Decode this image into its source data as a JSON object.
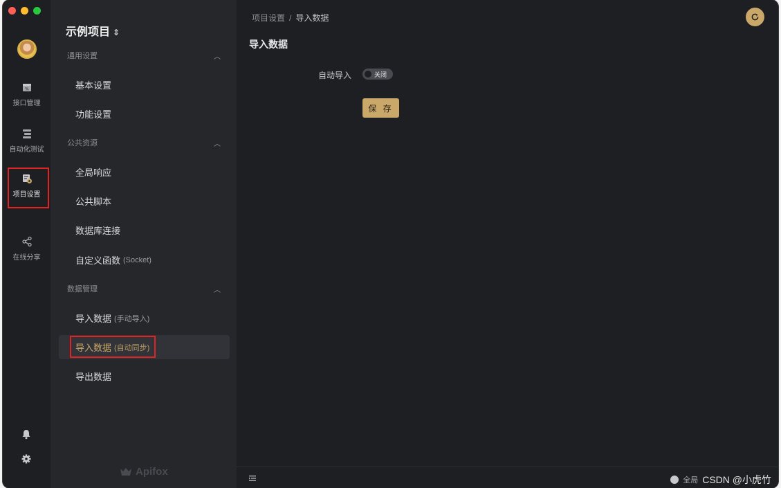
{
  "rail": {
    "items": [
      {
        "label": "接口管理",
        "icon": "api-icon"
      },
      {
        "label": "自动化测试",
        "icon": "automation-icon"
      },
      {
        "label": "项目设置",
        "icon": "project-settings-icon"
      },
      {
        "label": "在线分享",
        "icon": "share-icon"
      }
    ]
  },
  "sidebar": {
    "project_title": "示例项目",
    "groups": [
      {
        "title": "通用设置",
        "items": [
          {
            "label": "基本设置"
          },
          {
            "label": "功能设置"
          }
        ]
      },
      {
        "title": "公共资源",
        "items": [
          {
            "label": "全局响应"
          },
          {
            "label": "公共脚本"
          },
          {
            "label": "数据库连接"
          },
          {
            "label": "自定义函数",
            "sub": "(Socket)"
          }
        ]
      },
      {
        "title": "数据管理",
        "items": [
          {
            "label": "导入数据",
            "sub": "(手动导入)"
          },
          {
            "label": "导入数据",
            "sub": "(自动同步)"
          },
          {
            "label": "导出数据"
          }
        ]
      }
    ],
    "brand": "Apifox"
  },
  "main": {
    "breadcrumb": {
      "parent": "项目设置",
      "sep": "/",
      "current": "导入数据"
    },
    "title": "导入数据",
    "auto_import_label": "自动导入",
    "toggle_text": "关闭",
    "save_label": "保 存"
  },
  "footer": {
    "left_text": "全局",
    "watermark": "CSDN @小虎竹"
  },
  "colors": {
    "accent": "#c9a86a",
    "highlight_border": "#e02424"
  }
}
